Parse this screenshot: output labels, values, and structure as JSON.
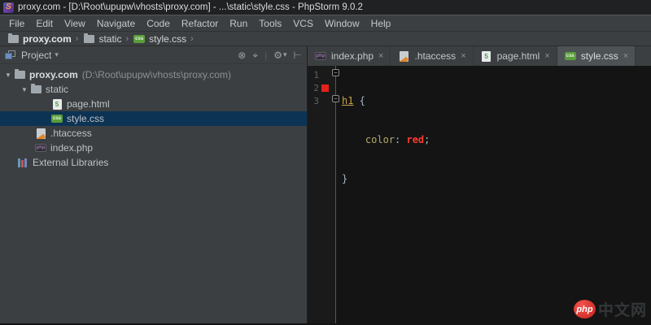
{
  "window": {
    "title": "proxy.com - [D:\\Root\\upupw\\vhosts\\proxy.com] - ...\\static\\style.css - PhpStorm 9.0.2"
  },
  "menu": {
    "items": [
      "File",
      "Edit",
      "View",
      "Navigate",
      "Code",
      "Refactor",
      "Run",
      "Tools",
      "VCS",
      "Window",
      "Help"
    ]
  },
  "breadcrumbs": {
    "items": [
      "proxy.com",
      "static",
      "style.css"
    ]
  },
  "project_panel": {
    "title": "Project",
    "tree": {
      "root_label": "proxy.com",
      "root_path": "(D:\\Root\\upupw\\vhosts\\proxy.com)",
      "static_label": "static",
      "page_html_label": "page.html",
      "style_css_label": "style.css",
      "htaccess_label": ".htaccess",
      "index_php_label": "index.php",
      "external_libraries_label": "External Libraries"
    }
  },
  "tabs": {
    "items": [
      "index.php",
      ".htaccess",
      "page.html",
      "style.css"
    ],
    "active": "style.css"
  },
  "editor_code": {
    "line_numbers": [
      "1",
      "2",
      "3"
    ],
    "line1_selector": "h1",
    "line1_rest": " {",
    "line2_indent": "    ",
    "line2_property": "color",
    "line2_colon": ": ",
    "line2_value": "red",
    "line2_semi": ";",
    "line3_text": "}"
  },
  "icons": {
    "app_logo_glyph": "S",
    "css_badge": "css",
    "html_badge": "5",
    "php_badge": "php",
    "close_glyph": "×",
    "chevron": "›",
    "dropdown_arrow": "▾",
    "tree_expanded_arrow": "▼",
    "collapse_all_glyph": "⊗",
    "scroll_source_glyph": "⌖",
    "header_separator_glyph": "|",
    "gear_glyph": "⚙",
    "hide_panel_glyph": "⊢",
    "fold_top_glyph": "−",
    "fold_bottom_glyph": "−"
  },
  "watermark": {
    "logo": "php",
    "text": "中文网"
  },
  "colors": {
    "selection_bg": "#0d3354",
    "panel_bg": "#3c3f41",
    "editor_bg": "#141414",
    "css_selector": "#c9a44a",
    "css_property": "#b3aa6a",
    "css_value_red": "#ff3b30",
    "gutter_swatch_red": "#e32219",
    "badge_green": "#5a9e3c",
    "php_purple": "#9876aa"
  }
}
